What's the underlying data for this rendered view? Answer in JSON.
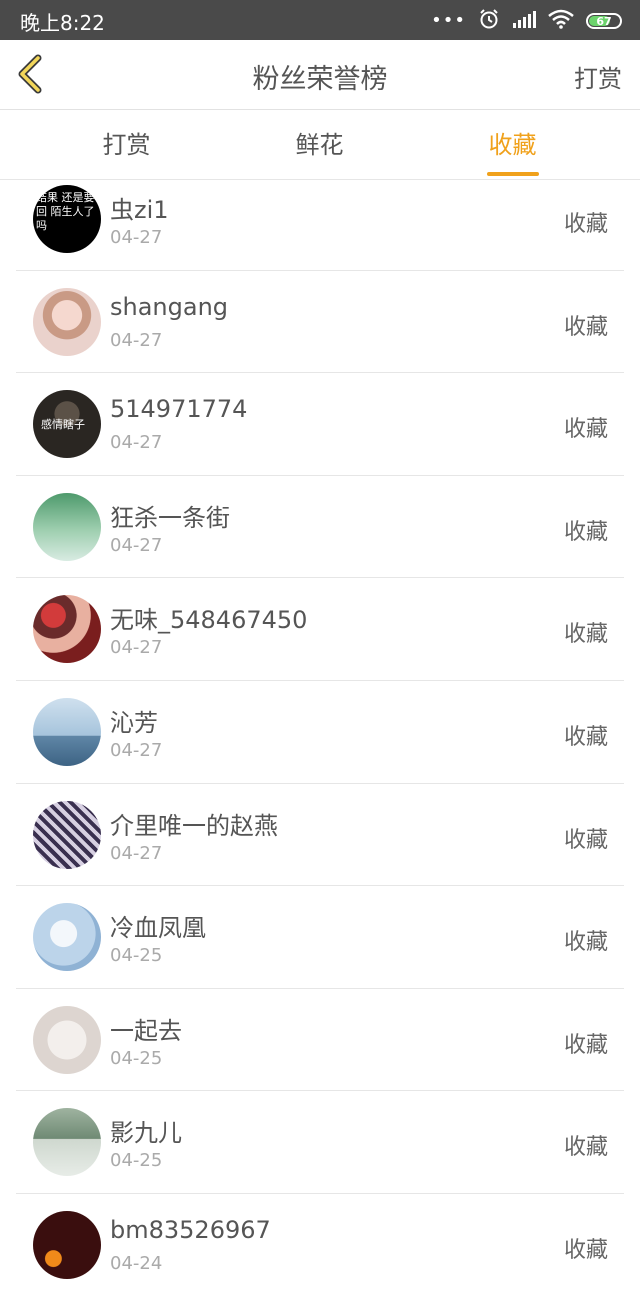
{
  "status_bar": {
    "time": "晚上8:22",
    "dots": "•••",
    "battery": "67",
    "icons": [
      "alarm-icon",
      "signal-icon",
      "wifi-icon",
      "battery-icon"
    ]
  },
  "header": {
    "title": "粉丝荣誉榜",
    "right_action": "打赏",
    "back_icon": "chevron-left-icon"
  },
  "tabs": [
    {
      "label": "打赏",
      "active": false
    },
    {
      "label": "鲜花",
      "active": false
    },
    {
      "label": "收藏",
      "active": true
    }
  ],
  "colors": {
    "accent": "#f0a11b",
    "status_bar": "#4a4a4a",
    "text": "#555555",
    "subtext": "#aaaaaa"
  },
  "list": [
    {
      "name": "虫zi1",
      "date": "04-27",
      "action": "收藏",
      "avatar_text": "结果 还是要回 陌生人了吗"
    },
    {
      "name": "shangang",
      "date": "04-27",
      "action": "收藏"
    },
    {
      "name": "514971774",
      "date": "04-27",
      "action": "收藏",
      "avatar_text": "感情瞎子"
    },
    {
      "name": "狂杀一条街",
      "date": "04-27",
      "action": "收藏"
    },
    {
      "name": "无味_548467450",
      "date": "04-27",
      "action": "收藏"
    },
    {
      "name": "沁芳",
      "date": "04-27",
      "action": "收藏"
    },
    {
      "name": "介里唯一的赵燕",
      "date": "04-27",
      "action": "收藏"
    },
    {
      "name": "冷血凤凰",
      "date": "04-25",
      "action": "收藏"
    },
    {
      "name": "一起去",
      "date": "04-25",
      "action": "收藏"
    },
    {
      "name": "影九儿",
      "date": "04-25",
      "action": "收藏"
    },
    {
      "name": "bm83526967",
      "date": "04-24",
      "action": "收藏"
    }
  ]
}
